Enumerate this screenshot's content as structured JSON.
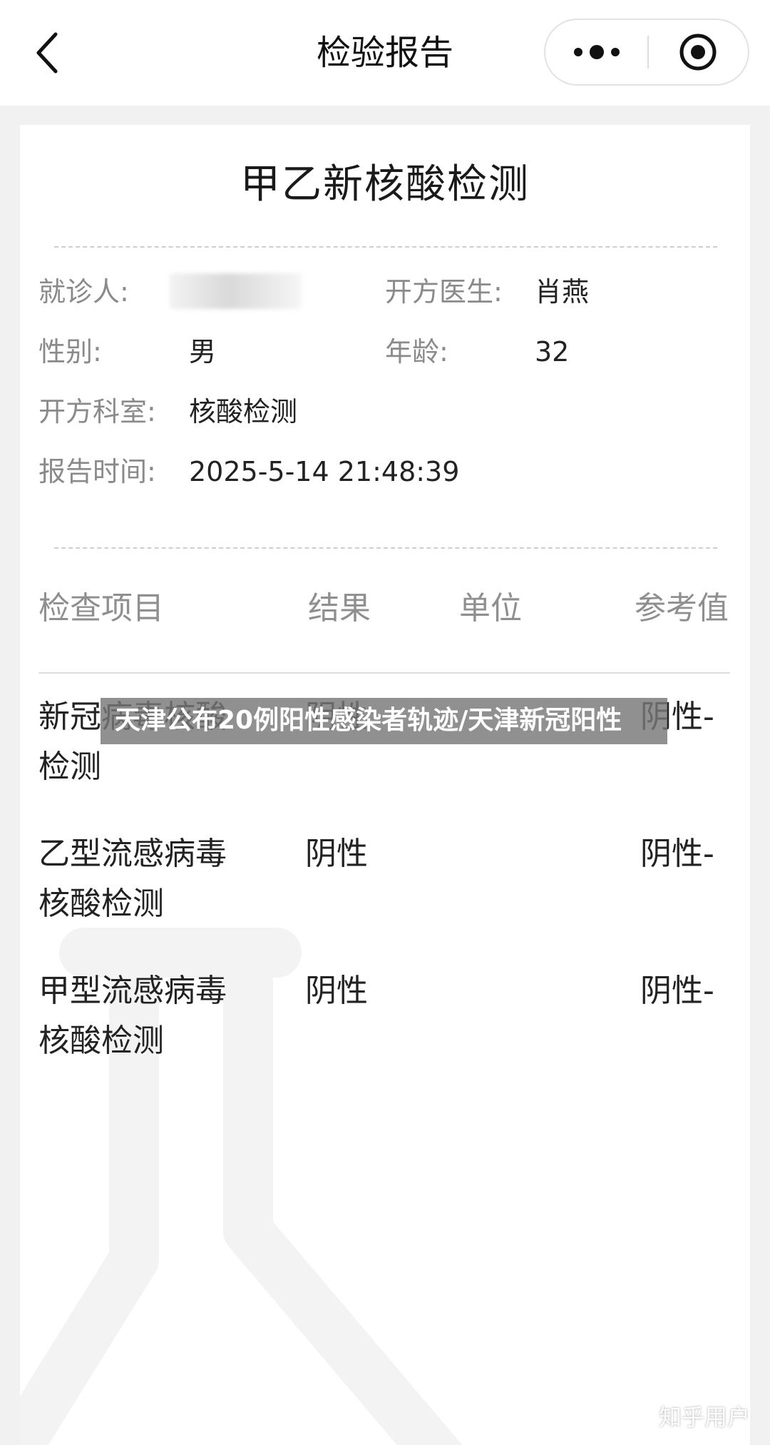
{
  "navbar": {
    "title": "检验报告",
    "back_icon": "chevron-left-icon",
    "more_icon": "more-dots-icon",
    "close_icon": "target-circle-icon"
  },
  "report": {
    "title": "甲乙新核酸检测",
    "patient_label": "就诊人:",
    "patient_value": "",
    "doctor_label": "开方医生:",
    "doctor_value": "肖燕",
    "gender_label": "性别:",
    "gender_value": "男",
    "age_label": "年龄:",
    "age_value": "32",
    "department_label": "开方科室:",
    "department_value": "核酸检测",
    "report_time_label": "报告时间:",
    "report_time_value": "2025-5-14 21:48:39"
  },
  "table": {
    "headers": [
      "检查项目",
      "结果",
      "单位",
      "参考值"
    ],
    "rows": [
      {
        "item": "新冠病毒核酸检测",
        "result": "阴性",
        "unit": "",
        "reference": "阴性-"
      },
      {
        "item": "乙型流感病毒核酸检测",
        "result": "阴性",
        "unit": "",
        "reference": "阴性-"
      },
      {
        "item": "甲型流感病毒核酸检测",
        "result": "阴性",
        "unit": "",
        "reference": "阴性-"
      }
    ]
  },
  "overlay": {
    "caption": "天津公布20例阳性感染者轨迹/天津新冠阳性"
  },
  "watermark": {
    "text": "知乎用户",
    "background_icon": "flask-icon"
  },
  "colors": {
    "page_background": "#f1f1f1",
    "card_background": "#ffffff",
    "label_gray": "#8a8a8a",
    "text_dark": "#222222"
  }
}
